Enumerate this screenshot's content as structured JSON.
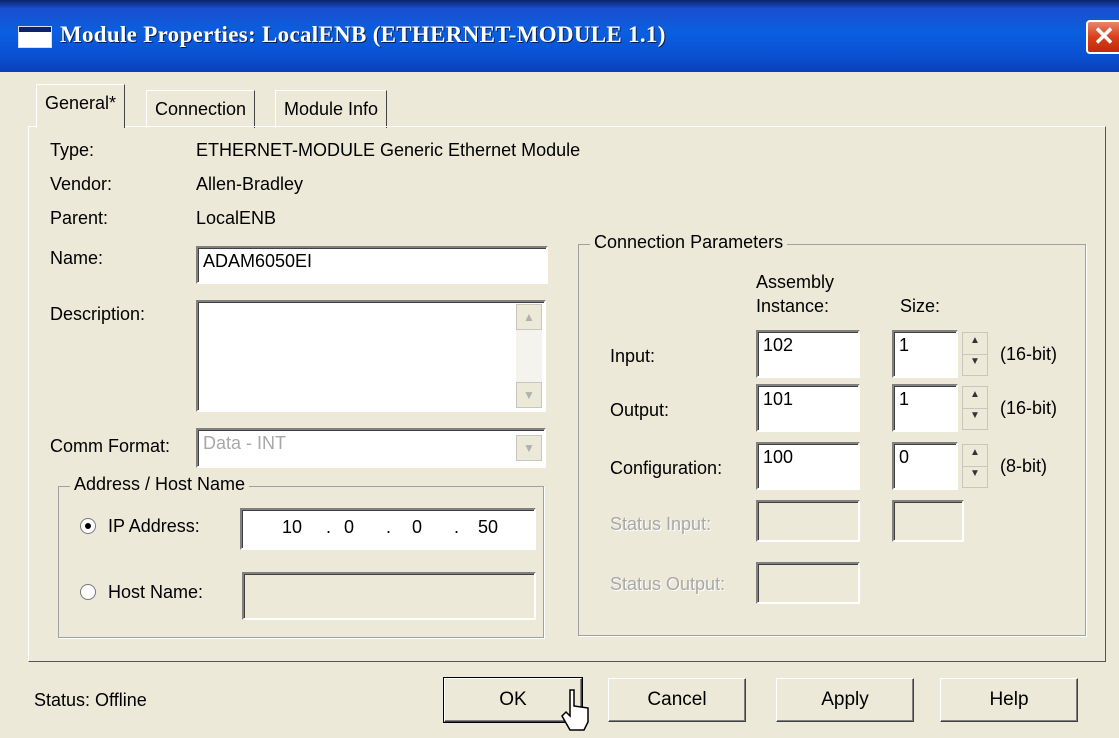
{
  "window": {
    "title": "Module Properties: LocalENB (ETHERNET-MODULE 1.1)",
    "close_glyph": "✕"
  },
  "tabs": [
    {
      "label": "General*",
      "active": true
    },
    {
      "label": "Connection",
      "active": false
    },
    {
      "label": "Module Info",
      "active": false
    }
  ],
  "general": {
    "type_label": "Type:",
    "type_value": "ETHERNET-MODULE Generic Ethernet Module",
    "vendor_label": "Vendor:",
    "vendor_value": "Allen-Bradley",
    "parent_label": "Parent:",
    "parent_value": "LocalENB",
    "name_label": "Name:",
    "name_value": "ADAM6050EI",
    "description_label": "Description:",
    "description_value": "",
    "comm_format_label": "Comm Format:",
    "comm_format_value": "Data - INT"
  },
  "address": {
    "group_title": "Address / Host Name",
    "ip_label": "IP Address:",
    "ip_octets": [
      "10",
      "0",
      "0",
      "50"
    ],
    "host_label": "Host Name:",
    "host_value": "",
    "selected": "ip"
  },
  "connection_params": {
    "group_title": "Connection Parameters",
    "col_assembly_line1": "Assembly",
    "col_assembly_line2": "Instance:",
    "col_size": "Size:",
    "rows": [
      {
        "label": "Input:",
        "instance": "102",
        "size": "1",
        "unit": "(16-bit)",
        "enabled": true
      },
      {
        "label": "Output:",
        "instance": "101",
        "size": "1",
        "unit": "(16-bit)",
        "enabled": true
      },
      {
        "label": "Configuration:",
        "instance": "100",
        "size": "0",
        "unit": "(8-bit)",
        "enabled": true
      },
      {
        "label": "Status Input:",
        "instance": "",
        "size": "",
        "unit": "",
        "enabled": false
      },
      {
        "label": "Status Output:",
        "instance": "",
        "size": "",
        "unit": "",
        "enabled": false
      }
    ]
  },
  "status": {
    "text": "Status:  Offline"
  },
  "buttons": {
    "ok": "OK",
    "cancel": "Cancel",
    "apply": "Apply",
    "help": "Help"
  },
  "icons": {
    "title": "window-icon",
    "close": "close-icon",
    "scroll_up": "scroll-up-arrow-icon",
    "scroll_down": "scroll-down-arrow-icon",
    "dropdown": "dropdown-arrow-icon",
    "spin": "spin-arrows-icon",
    "cursor": "mouse-pointer-icon"
  }
}
